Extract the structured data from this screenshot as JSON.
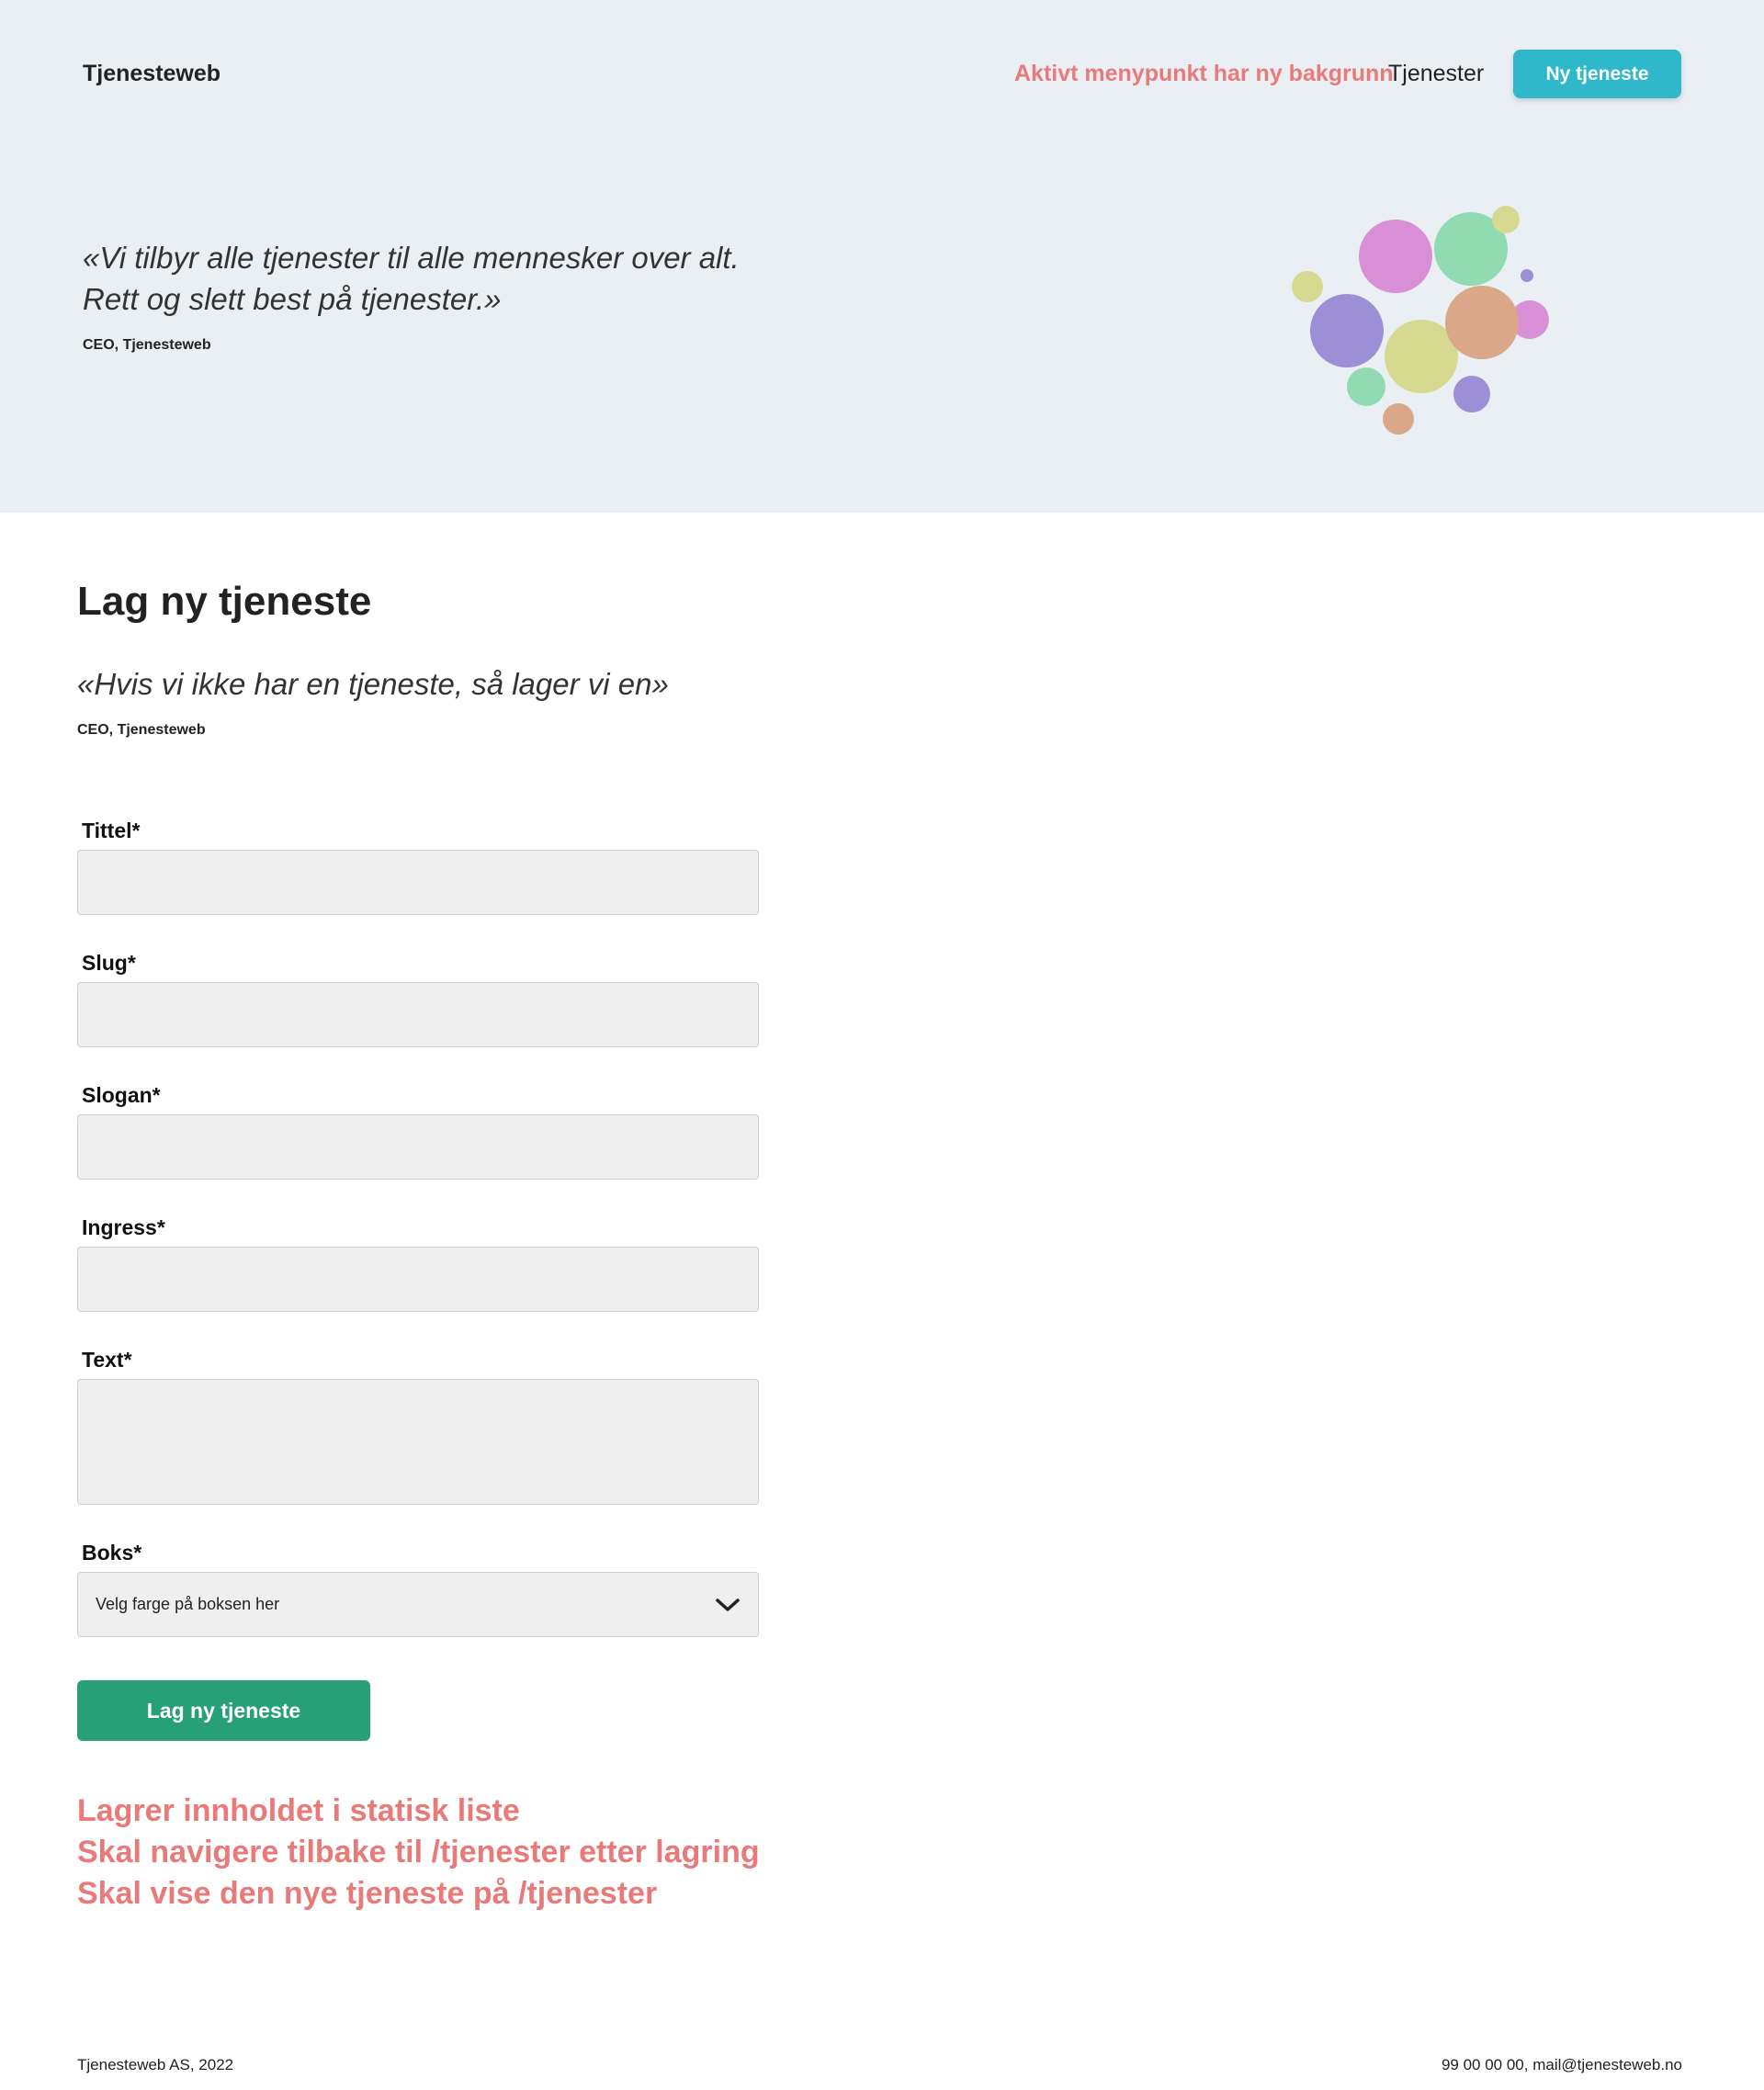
{
  "header": {
    "logo": "Tjenesteweb",
    "nav_active": "Aktivt menypunkt har ny bakgrunn",
    "nav_services": "Tjenester",
    "cta": "Ny tjeneste"
  },
  "hero": {
    "quote_line1": "«Vi tilbyr alle tjenester til alle mennesker over alt.",
    "quote_line2": "Rett og slett best på tjenester.»",
    "author": "CEO, Tjenesteweb"
  },
  "main": {
    "title": "Lag ny tjeneste",
    "quote": "«Hvis vi ikke har en tjeneste, så lager vi en»",
    "author": "CEO, Tjenesteweb"
  },
  "form": {
    "title_label": "Tittel*",
    "slug_label": "Slug*",
    "slogan_label": "Slogan*",
    "ingress_label": "Ingress*",
    "text_label": "Text*",
    "box_label": "Boks*",
    "box_placeholder": "Velg farge på boksen her",
    "submit": "Lag ny tjeneste"
  },
  "notes": [
    "Lagrer innholdet i statisk liste",
    "Skal navigere tilbake til /tjenester etter lagring",
    "Skal vise den nye tjeneste på /tjenester"
  ],
  "footer": {
    "left": "Tjenesteweb AS, 2022",
    "right": "99 00 00 00, mail@tjenesteweb.no"
  },
  "colors": {
    "hero_bg": "#eaeff3",
    "accent_red": "#e97a7a",
    "cta_teal": "#2eb8c9",
    "submit_green": "#27a077"
  }
}
